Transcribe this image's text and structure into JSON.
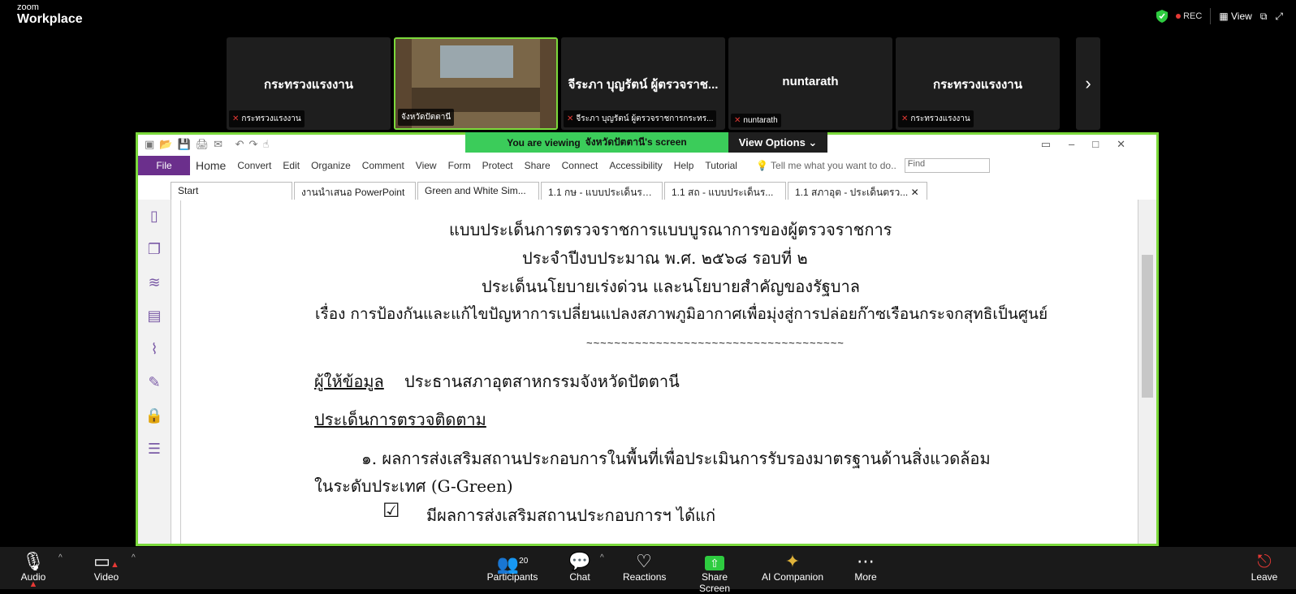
{
  "app": {
    "brand_small": "zoom",
    "brand_big": "Workplace",
    "rec": "REC",
    "view": "View"
  },
  "tiles": [
    {
      "big": "กระทรวงแรงงาน",
      "tag": "กระทรวงแรงงาน"
    },
    {
      "big": "",
      "tag": "จังหวัดปัตตานี"
    },
    {
      "big": "จีระภา บุญรัตน์ ผู้ตรวจราช...",
      "tag": "จีระภา บุญรัตน์ ผู้ตรวจราชการกระทร..."
    },
    {
      "big": "nuntarath",
      "tag": "nuntarath"
    },
    {
      "big": "กระทรวงแรงงาน",
      "tag": "กระทรวงแรงงาน"
    }
  ],
  "banner": {
    "viewing": "You are viewing",
    "owner": "จังหวัดปัตตานี's screen",
    "options": "View Options"
  },
  "ribbon": {
    "file": "File",
    "menus": [
      "Home",
      "Convert",
      "Edit",
      "Organize",
      "Comment",
      "View",
      "Form",
      "Protect",
      "Share",
      "Connect",
      "Accessibility",
      "Help",
      "Tutorial"
    ],
    "tell": "Tell me what you want to do..",
    "find": "Find"
  },
  "tabs": [
    "Start",
    "งานนำเสนอ PowerPoint",
    "Green and White Sim...",
    "1.1 กษ - แบบประเด็นรา...",
    "1.1 สถ - แบบประเด็นร...",
    "1.1 สภาอุต - ประเด็นตรว..."
  ],
  "doc": {
    "l1": "แบบประเด็นการตรวจราชการแบบบูรณาการของผู้ตรวจราชการ",
    "l2": "ประจำปีงบประมาณ พ.ศ. ๒๕๖๘ รอบที่ ๒",
    "l3": "ประเด็นนโยบายเร่งด่วน และนโยบายสำคัญของรัฐบาล",
    "l4": "เรื่อง การป้องกันและแก้ไขปัญหาการเปลี่ยนแปลงสภาพภูมิอากาศเพื่อมุ่งสู่การปล่อยก๊าซเรือนกระจกสุทธิเป็นศูนย์",
    "provider_label": "ผู้ให้ข้อมูล",
    "provider": "ประธานสภาอุตสาหกรรมจังหวัดปัตตานี",
    "section": "ประเด็นการตรวจติดตาม",
    "item1a": "๑. ผลการส่งเสริมสถานประกอบการในพื้นที่เพื่อประเมินการรับรองมาตรฐานด้านสิ่งแวดล้อม",
    "item1b": "ในระดับประเทศ (G-Green)",
    "checkbox": "☑",
    "check_text": "มีผลการส่งเสริมสถานประกอบการฯ ได้แก่"
  },
  "bottom": {
    "audio": "Audio",
    "video": "Video",
    "participants": "Participants",
    "count": "20",
    "chat": "Chat",
    "reactions": "Reactions",
    "share": "Share Screen",
    "ai": "AI Companion",
    "more": "More",
    "leave": "Leave"
  }
}
